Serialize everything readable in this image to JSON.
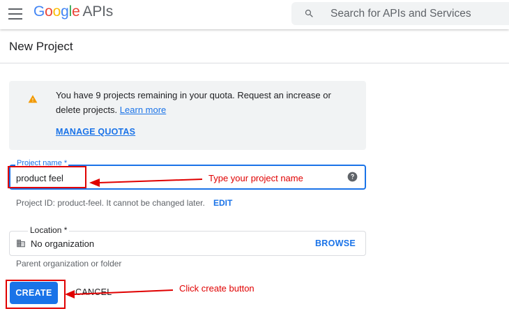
{
  "header": {
    "logo_google": "Google",
    "logo_apis": "APIs",
    "search_placeholder": "Search for APIs and Services"
  },
  "page": {
    "title": "New Project"
  },
  "quota": {
    "message": "You have 9 projects remaining in your quota. Request an increase or delete projects.",
    "learn_more": "Learn more",
    "manage_label": "MANAGE QUOTAS"
  },
  "project_name": {
    "label": "Project name *",
    "value": "product feel"
  },
  "project_id": {
    "text": "Project ID: product-feel. It cannot be changed later.",
    "edit_label": "EDIT"
  },
  "location": {
    "label": "Location *",
    "value": "No organization",
    "browse_label": "BROWSE",
    "helper": "Parent organization or folder"
  },
  "actions": {
    "create_label": "CREATE",
    "cancel_label": "CANCEL"
  },
  "annotations": {
    "name_note": "Type your project name",
    "create_note": "Click create button",
    "color": "#e00000"
  },
  "colors": {
    "accent": "#1a73e8",
    "warning": "#f29900"
  }
}
